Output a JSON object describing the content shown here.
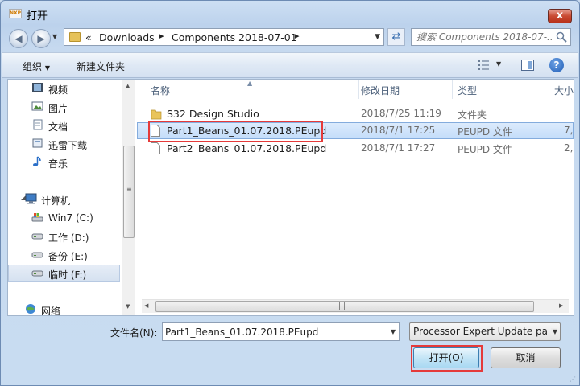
{
  "window": {
    "title": "打开",
    "app_icon_text": "NXP",
    "close_label": "x"
  },
  "address": {
    "crumb_overflow": "«",
    "crumbs": [
      "Downloads",
      "Components 2018-07-01"
    ],
    "search_placeholder": "搜索 Components 2018-07-..."
  },
  "toolbar": {
    "organize": "组织",
    "new_folder": "新建文件夹",
    "help": "?"
  },
  "navpane": {
    "items": [
      {
        "label": "视频",
        "icon": "video-icon"
      },
      {
        "label": "图片",
        "icon": "pictures-icon"
      },
      {
        "label": "文档",
        "icon": "documents-icon"
      },
      {
        "label": "迅雷下载",
        "icon": "thunder-download-icon"
      },
      {
        "label": "音乐",
        "icon": "music-icon"
      },
      {
        "label": "计算机",
        "icon": "computer-icon"
      },
      {
        "label": "Win7 (C:)",
        "icon": "system-drive-icon"
      },
      {
        "label": "工作 (D:)",
        "icon": "drive-icon"
      },
      {
        "label": "备份 (E:)",
        "icon": "drive-icon"
      },
      {
        "label": "临时 (F:)",
        "icon": "drive-icon"
      },
      {
        "label": "网络",
        "icon": "network-icon"
      }
    ],
    "selected": "临时 (F:)"
  },
  "filelist": {
    "columns": {
      "name": "名称",
      "date": "修改日期",
      "type": "类型",
      "size": "大小"
    },
    "rows": [
      {
        "name": "S32 Design Studio",
        "date": "2018/7/25 11:19",
        "type": "文件夹",
        "size": "",
        "icon": "folder-icon"
      },
      {
        "name": "Part1_Beans_01.07.2018.PEupd",
        "date": "2018/7/1 17:25",
        "type": "PEUPD 文件",
        "size": "7,",
        "icon": "file-icon"
      },
      {
        "name": "Part2_Beans_01.07.2018.PEupd",
        "date": "2018/7/1 17:27",
        "type": "PEUPD 文件",
        "size": "2,",
        "icon": "file-icon"
      }
    ],
    "selected_row": 1
  },
  "bottom": {
    "filename_label": "文件名(N):",
    "filename_value": "Part1_Beans_01.07.2018.PEupd",
    "filter_value": "Processor Expert Update pa",
    "open_label": "打开(O)",
    "cancel_label": "取消"
  },
  "colors": {
    "highlight": "#e53a3a",
    "selection": "#c4ddfa"
  }
}
